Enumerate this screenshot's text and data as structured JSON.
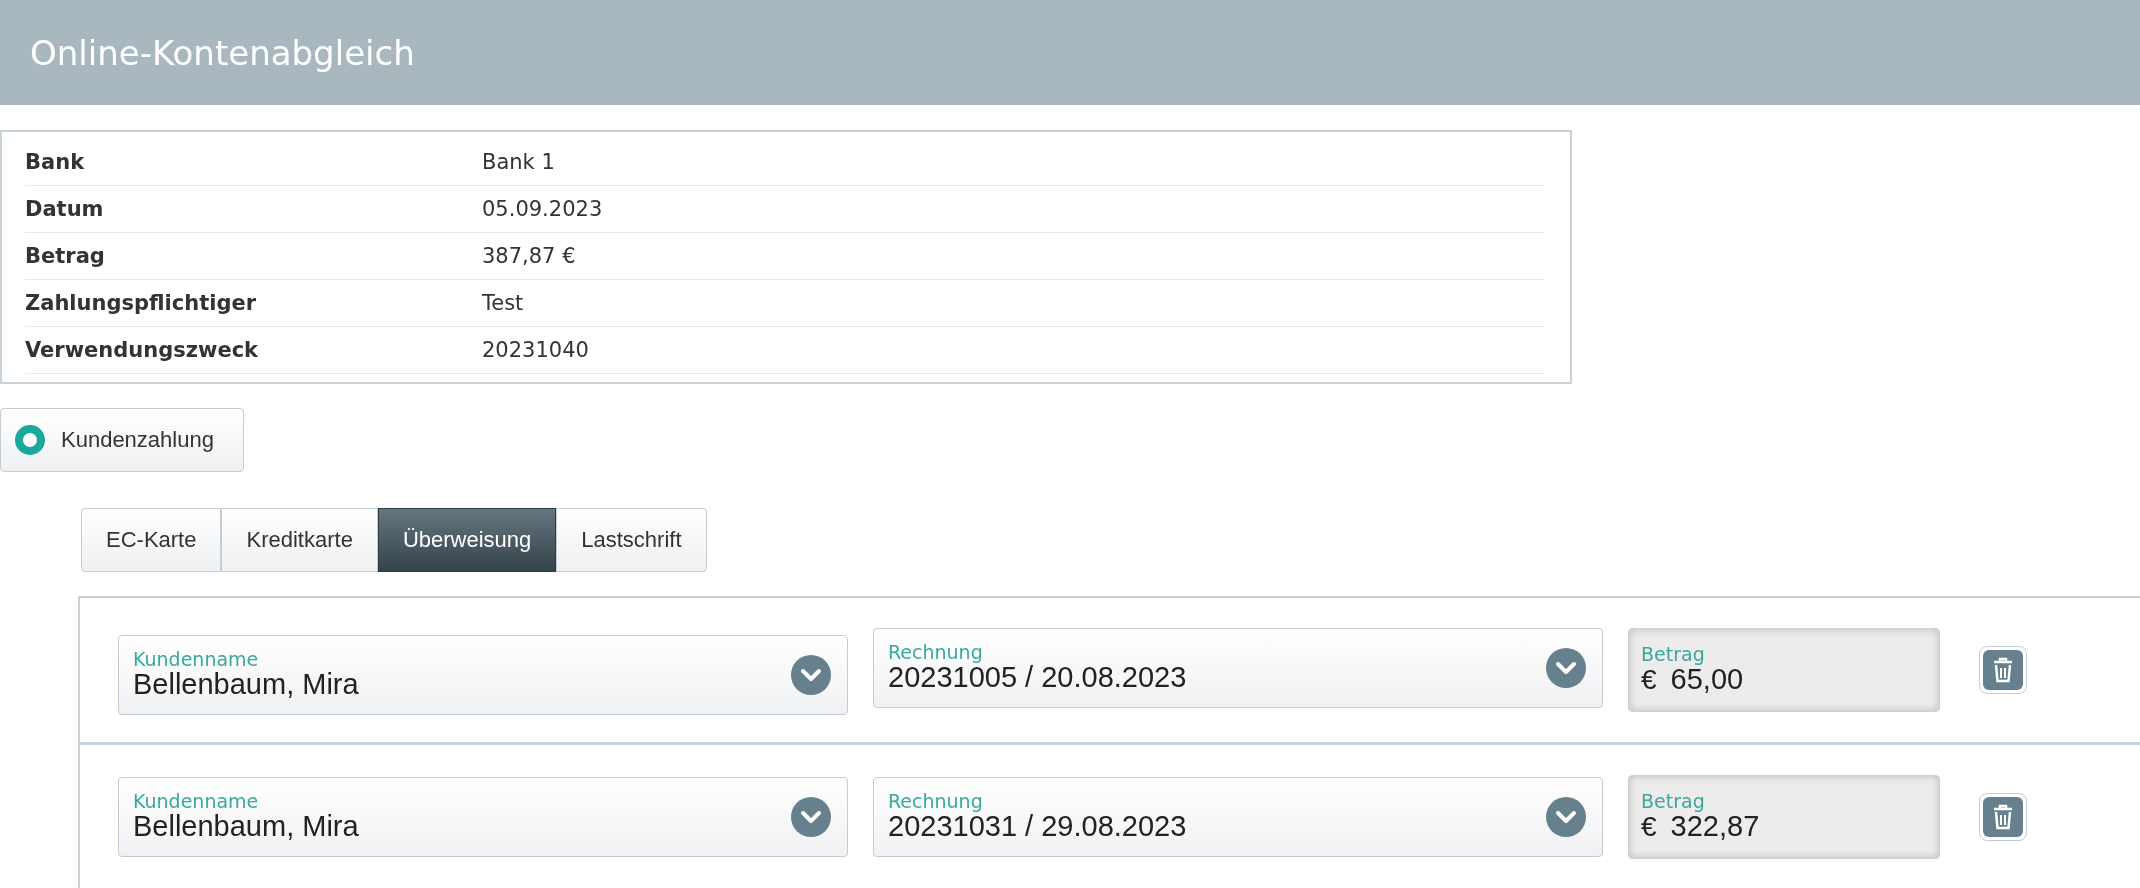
{
  "header": {
    "title": "Online-Kontenabgleich"
  },
  "details": [
    {
      "label": "Bank",
      "value": "Bank 1"
    },
    {
      "label": "Datum",
      "value": "05.09.2023"
    },
    {
      "label": "Betrag",
      "value": "387,87 €"
    },
    {
      "label": "Zahlungspflichtiger",
      "value": "Test"
    },
    {
      "label": "Verwendungszweck",
      "value": "20231040"
    }
  ],
  "payment_type": {
    "label": "Kundenzahlung",
    "selected": true
  },
  "tabs": [
    {
      "label": "EC-Karte",
      "selected": false
    },
    {
      "label": "Kreditkarte",
      "selected": false
    },
    {
      "label": "Überweisung",
      "selected": true
    },
    {
      "label": "Lastschrift",
      "selected": false
    }
  ],
  "rows": [
    {
      "customer_label": "Kundenname",
      "customer": "Bellenbaum, Mira",
      "invoice_label": "Rechnung",
      "invoice": "20231005 / 20.08.2023",
      "amount_label": "Betrag",
      "currency": "€",
      "amount": "65,00"
    },
    {
      "customer_label": "Kundenname",
      "customer": "Bellenbaum, Mira",
      "invoice_label": "Rechnung",
      "invoice": "20231031 / 29.08.2023",
      "amount_label": "Betrag",
      "currency": "€",
      "amount": "322,87"
    }
  ]
}
